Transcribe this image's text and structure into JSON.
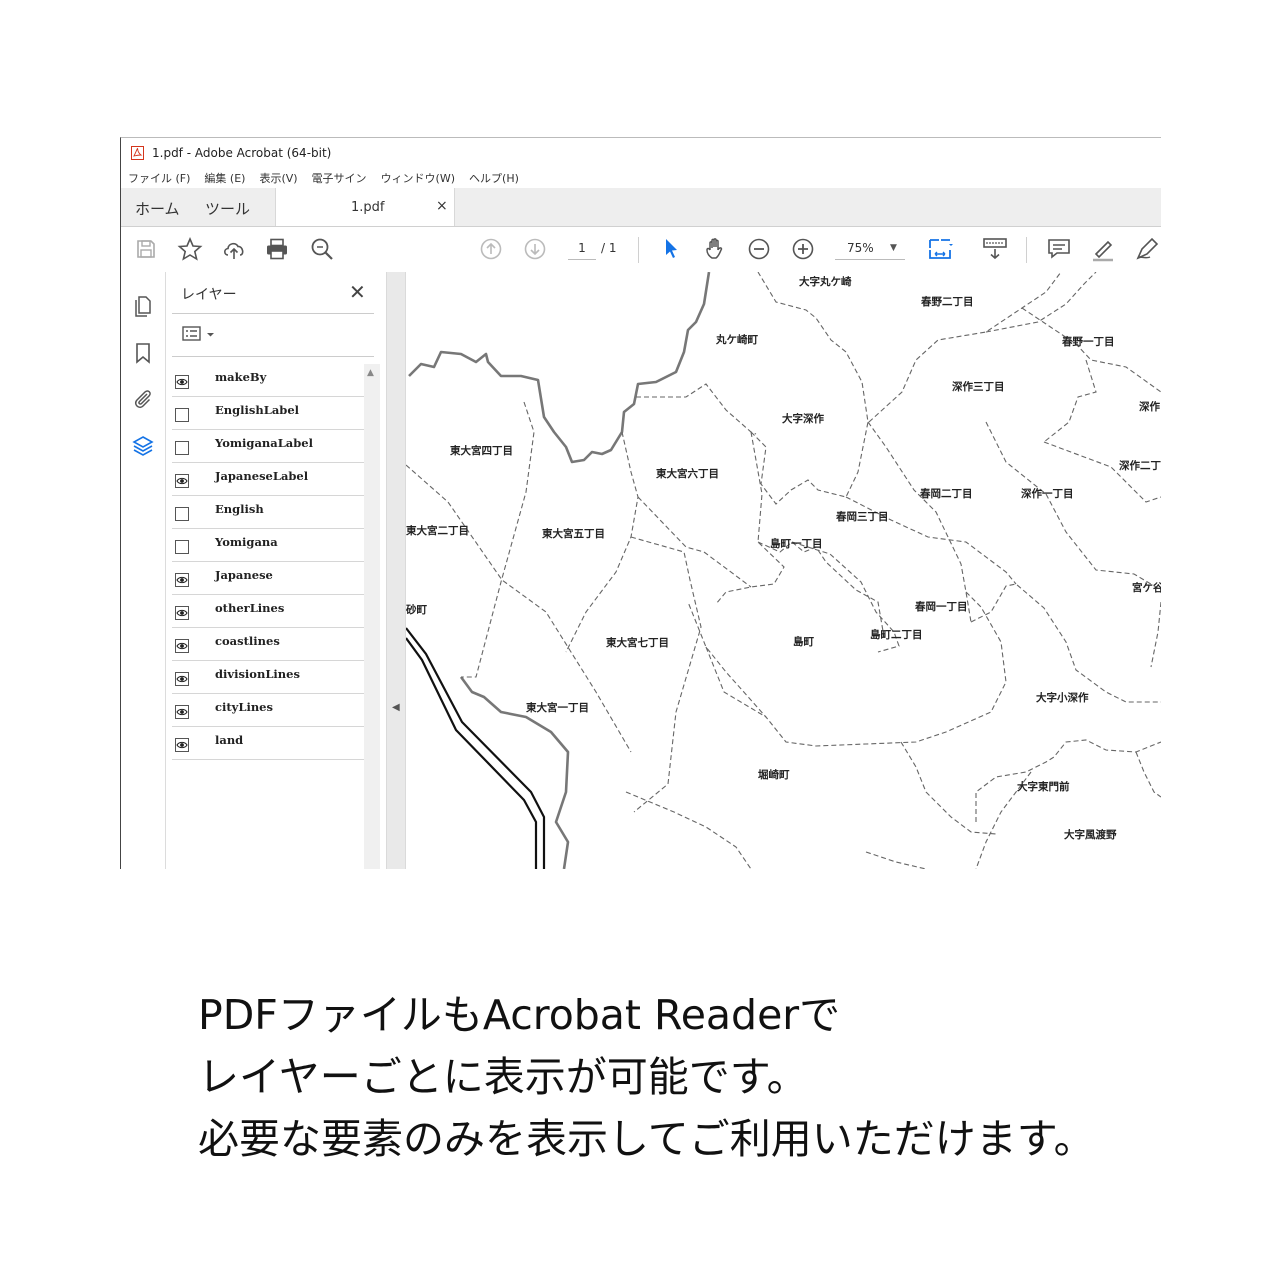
{
  "window": {
    "title": "1.pdf - Adobe Acrobat (64-bit)",
    "app_icon": "acrobat-pdf-icon"
  },
  "menubar": {
    "items": [
      {
        "label": "ファイル (F)"
      },
      {
        "label": "編集 (E)"
      },
      {
        "label": "表示(V)"
      },
      {
        "label": "電子サイン"
      },
      {
        "label": "ウィンドウ(W)"
      },
      {
        "label": "ヘルプ(H)"
      }
    ]
  },
  "tabs": {
    "home": "ホーム",
    "tools": "ツール",
    "document": "1.pdf",
    "close_glyph": "×"
  },
  "toolbar": {
    "page_current": "1",
    "page_total": "/ 1",
    "zoom": "75%",
    "accent_color": "#1473e6"
  },
  "layer_panel": {
    "title": "レイヤー",
    "close_glyph": "✕",
    "layers": [
      {
        "name": "makeBy",
        "visible": true
      },
      {
        "name": "EnglishLabel",
        "visible": false
      },
      {
        "name": "YomiganaLabel",
        "visible": false
      },
      {
        "name": "JapaneseLabel",
        "visible": true
      },
      {
        "name": "English",
        "visible": false
      },
      {
        "name": "Yomigana",
        "visible": false
      },
      {
        "name": "Japanese",
        "visible": true
      },
      {
        "name": "otherLines",
        "visible": true
      },
      {
        "name": "coastlines",
        "visible": true
      },
      {
        "name": "divisionLines",
        "visible": true
      },
      {
        "name": "cityLines",
        "visible": true
      },
      {
        "name": "land",
        "visible": true
      }
    ]
  },
  "map_labels": [
    "大字丸ケ崎",
    "春野二丁目",
    "丸ケ崎町",
    "春野一丁目",
    "深作三丁目",
    "深作",
    "大字深作",
    "東大宮四丁目",
    "深作二丁",
    "東大宮六丁目",
    "春岡二丁目",
    "深作一丁目",
    "春岡三丁目",
    "東大宮二丁目",
    "東大宮五丁目",
    "島町一丁目",
    "宮ケ谷",
    "春岡一丁目",
    "島町二丁目",
    "東大宮七丁目",
    "島町",
    "大字小深作",
    "東大宮一丁目",
    "堀崎町",
    "大字東門前",
    "大字風渡野",
    "砂町"
  ],
  "caption": {
    "line1": "PDFファイルもAcrobat Readerで",
    "line2": "レイヤーごとに表示が可能です。",
    "line3": "必要な要素のみを表示してご利用いただけます。"
  }
}
